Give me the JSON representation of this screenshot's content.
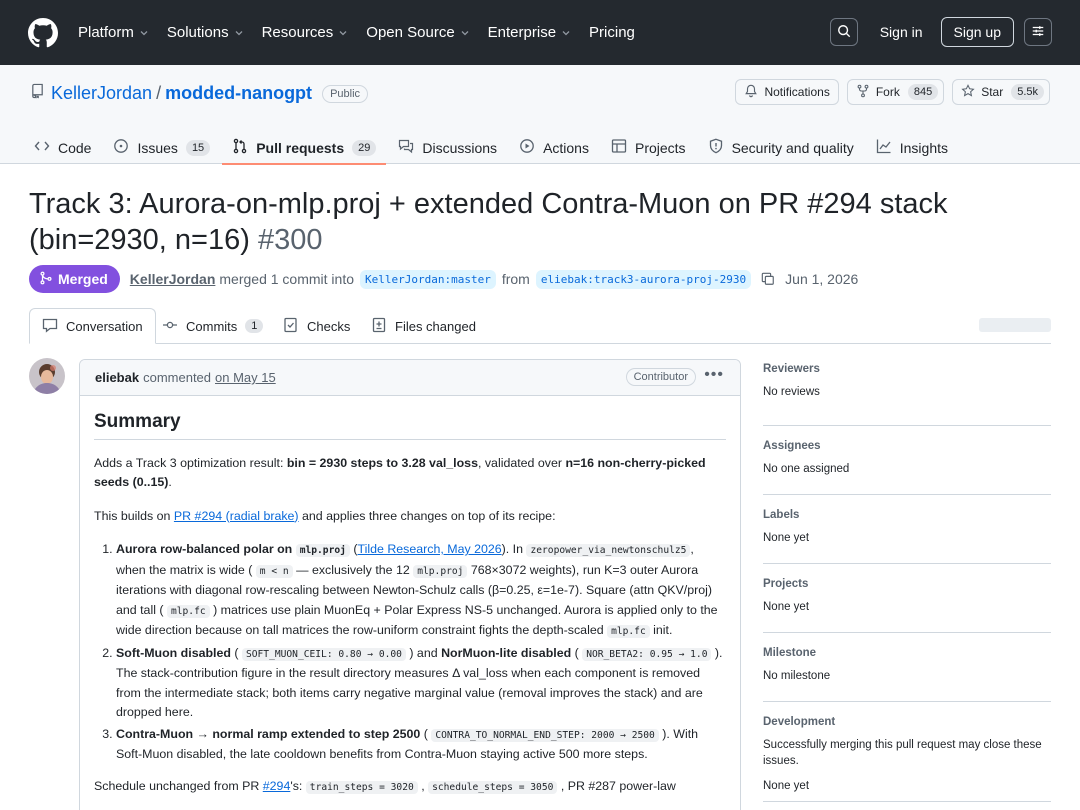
{
  "header": {
    "nav": [
      "Platform",
      "Solutions",
      "Resources",
      "Open Source",
      "Enterprise",
      "Pricing"
    ],
    "sign_in": "Sign in",
    "sign_up": "Sign up"
  },
  "repo": {
    "owner": "KellerJordan",
    "name": "modded-nanogpt",
    "visibility": "Public",
    "notifications": "Notifications",
    "fork": "Fork",
    "fork_count": "845",
    "star": "Star",
    "star_count": "5.5k",
    "tabs": [
      {
        "label": "Code"
      },
      {
        "label": "Issues",
        "count": "15"
      },
      {
        "label": "Pull requests",
        "count": "29"
      },
      {
        "label": "Discussions"
      },
      {
        "label": "Actions"
      },
      {
        "label": "Projects"
      },
      {
        "label": "Security and quality"
      },
      {
        "label": "Insights"
      }
    ]
  },
  "pr": {
    "title": "Track 3: Aurora-on-mlp.proj + extended Contra-Muon on PR #294 stack (bin=2930, n=16)",
    "number": "#300",
    "state": "Merged",
    "author": "KellerJordan",
    "merged_text": "merged 1 commit into",
    "base": "KellerJordan:master",
    "from": "from",
    "head": "eliebak:track3-aurora-proj-2930",
    "date": "Jun 1, 2026",
    "tabs": [
      {
        "label": "Conversation"
      },
      {
        "label": "Commits",
        "count": "1"
      },
      {
        "label": "Checks"
      },
      {
        "label": "Files changed"
      }
    ]
  },
  "comment": {
    "author": "eliebak",
    "action": "commented",
    "date": "on May 15",
    "badge": "Contributor",
    "heading": "Summary"
  },
  "sidebar": [
    {
      "title": "Reviewers",
      "value": "No reviews"
    },
    {
      "title": "Assignees",
      "value": "No one assigned"
    },
    {
      "title": "Labels",
      "value": "None yet"
    },
    {
      "title": "Projects",
      "value": "None yet"
    },
    {
      "title": "Milestone",
      "value": "No milestone"
    },
    {
      "title": "Development",
      "value": "Successfully merging this pull request may close these issues.",
      "value2": "None yet"
    }
  ]
}
